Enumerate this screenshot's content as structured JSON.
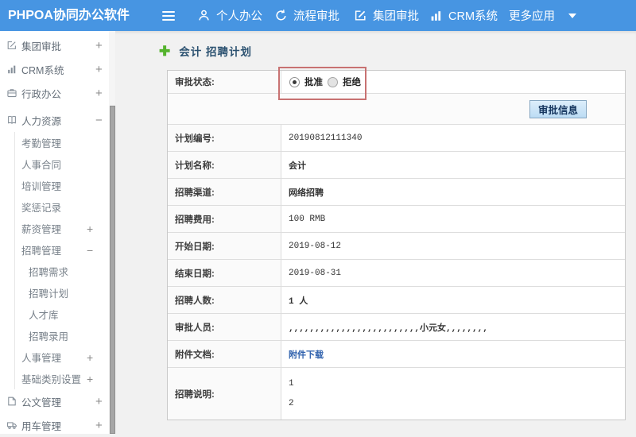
{
  "topbar": {
    "brand": "PHPOA协同办公软件",
    "nav": [
      {
        "label": "个人办公",
        "icon": "user-icon"
      },
      {
        "label": "流程审批",
        "icon": "process-approval-icon"
      },
      {
        "label": "集团审批",
        "icon": "edit-square-icon"
      },
      {
        "label": "CRM系统",
        "icon": "bar-chart-icon"
      },
      {
        "label": "更多应用",
        "icon": "caret-down-icon"
      }
    ]
  },
  "sidebar": {
    "items": [
      {
        "label": "集团审批",
        "level": 1,
        "expander": "+",
        "icon": "edit-square-icon"
      },
      {
        "label": "CRM系统",
        "level": 1,
        "expander": "+",
        "icon": "bar-chart-icon"
      },
      {
        "label": "行政办公",
        "level": 1,
        "expander": "+",
        "icon": "briefcase-icon"
      },
      {
        "label": "人力资源",
        "level": 1,
        "expander": "−",
        "icon": "book-icon"
      },
      {
        "label": "考勤管理",
        "level": 2
      },
      {
        "label": "人事合同",
        "level": 2
      },
      {
        "label": "培训管理",
        "level": 2
      },
      {
        "label": "奖惩记录",
        "level": 2
      },
      {
        "label": "薪资管理",
        "level": 2,
        "expander": "+"
      },
      {
        "label": "招聘管理",
        "level": 2,
        "expander": "−"
      },
      {
        "label": "招聘需求",
        "level": 3
      },
      {
        "label": "招聘计划",
        "level": 3
      },
      {
        "label": "人才库",
        "level": 3
      },
      {
        "label": "招聘录用",
        "level": 3
      },
      {
        "label": "人事管理",
        "level": 2,
        "expander": "+"
      },
      {
        "label": "基础类别设置",
        "level": 2,
        "expander": "+"
      },
      {
        "label": "公文管理",
        "level": 1,
        "expander": "+",
        "icon": "document-icon"
      },
      {
        "label": "用车管理",
        "level": 1,
        "expander": "+",
        "icon": "truck-icon"
      }
    ]
  },
  "main": {
    "title": "会计 招聘计划",
    "approve_info_button": "审批信息",
    "status_row": {
      "label": "审批状态:",
      "options": [
        {
          "label": "批准",
          "selected": true
        },
        {
          "label": "拒绝",
          "selected": false
        }
      ]
    },
    "rows": [
      {
        "label": "计划编号:",
        "value": "20190812111340"
      },
      {
        "label": "计划名称:",
        "value": "会计"
      },
      {
        "label": "招聘渠道:",
        "value": "网络招聘"
      },
      {
        "label": "招聘费用:",
        "value": "100 RMB"
      },
      {
        "label": "开始日期:",
        "value": "2019-08-12"
      },
      {
        "label": "结束日期:",
        "value": "2019-08-31"
      },
      {
        "label": "招聘人数:",
        "value": "1 人"
      },
      {
        "label": "审批人员:",
        "value": ",,,,,,,,,,,,,,,,,,,,,,,,,小元女,,,,,,,,"
      },
      {
        "label": "附件文档:",
        "value": "附件下载"
      }
    ],
    "desc_row": {
      "label": "招聘说明:",
      "lines": [
        "1",
        "2"
      ]
    }
  }
}
